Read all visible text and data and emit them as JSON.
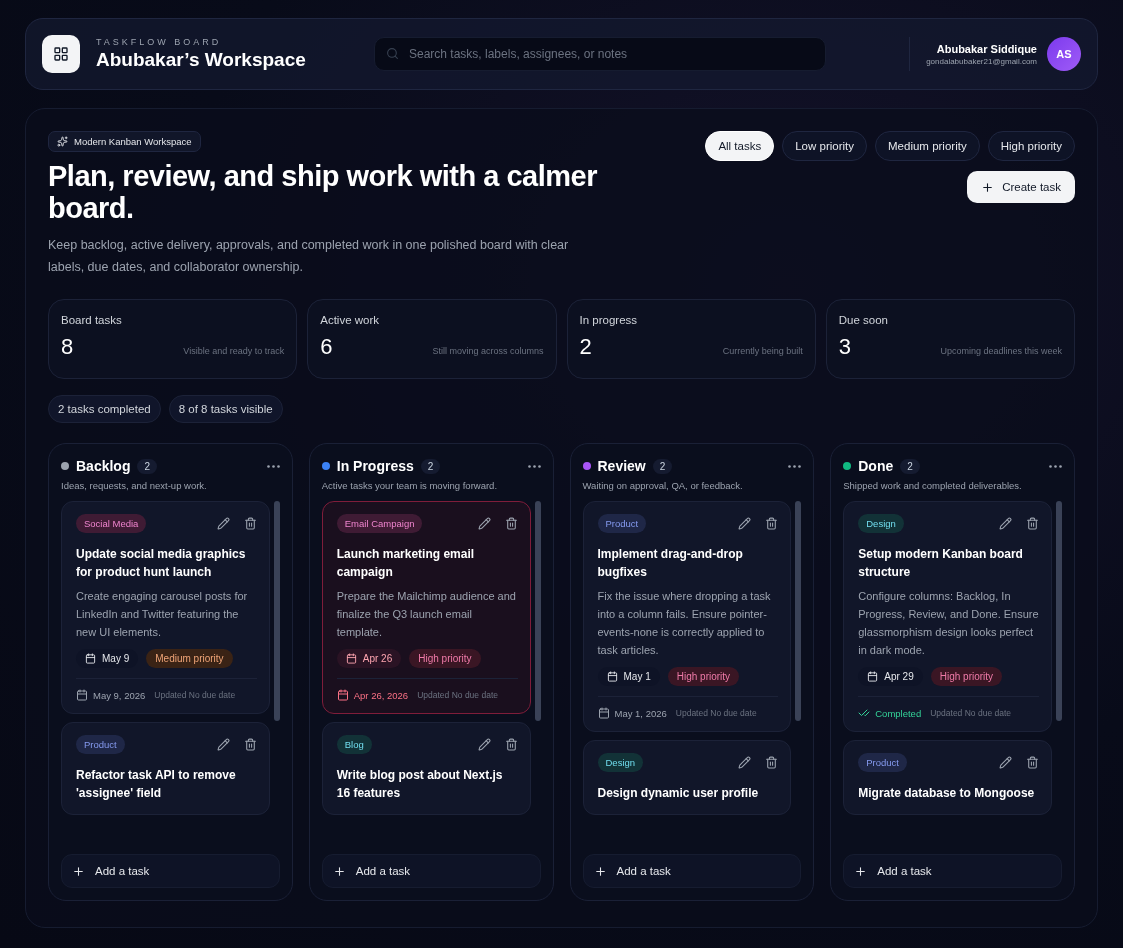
{
  "header": {
    "eyebrow": "TASKFLOW BOARD",
    "title": "Abubakar’s Workspace",
    "search": {
      "placeholder": "Search tasks, labels, assignees, or notes"
    },
    "user": {
      "name": "Abubakar Siddique",
      "email": "gondalabubaker21@gmail.com",
      "initials": "AS"
    }
  },
  "hero": {
    "badge": "Modern Kanban Workspace",
    "title": "Plan, review, and ship work with a calmer board.",
    "description": "Keep backlog, active delivery, approvals, and completed work in one polished board with clear labels, due dates, and collaborator ownership.",
    "filters": [
      {
        "label": "All tasks",
        "selected": true
      },
      {
        "label": "Low priority",
        "selected": false
      },
      {
        "label": "Medium priority",
        "selected": false
      },
      {
        "label": "High priority",
        "selected": false
      }
    ],
    "create_button": "Create task"
  },
  "stats": [
    {
      "label": "Board tasks",
      "value": "8",
      "note": "Visible and ready to track"
    },
    {
      "label": "Active work",
      "value": "6",
      "note": "Still moving across columns"
    },
    {
      "label": "In progress",
      "value": "2",
      "note": "Currently being built"
    },
    {
      "label": "Due soon",
      "value": "3",
      "note": "Upcoming deadlines this week"
    }
  ],
  "summary": [
    "2 tasks completed",
    "8 of 8 tasks visible"
  ],
  "columns": [
    {
      "title": "Backlog",
      "color": "#9ca3af",
      "count": "2",
      "description": "Ideas, requests, and next-up work.",
      "add_label": "Add a task",
      "tasks": [
        {
          "tag": {
            "label": "Social Media",
            "color": "#3f1b34"
          },
          "title": "Update social media graphics for product hunt launch",
          "description": "Create engaging carousel posts for LinkedIn and Twitter featuring the new UI elements.",
          "date_chip": "May 9",
          "priority": {
            "label": "Medium priority",
            "color": "#3a2315"
          },
          "due": "May 9, 2026",
          "updated": "Updated No due date",
          "overdue": false,
          "completed": false
        },
        {
          "tag": {
            "label": "Product",
            "color": "#1f2747"
          },
          "title": "Refactor task API to remove 'assignee' field"
        }
      ]
    },
    {
      "title": "In Progress",
      "color": "#3b82f6",
      "count": "2",
      "description": "Active tasks your team is moving forward.",
      "add_label": "Add a task",
      "tasks": [
        {
          "tag": {
            "label": "Email Campaign",
            "color": "#3f1b34"
          },
          "title": "Launch marketing email campaign",
          "description": "Prepare the Mailchimp audience and finalize the Q3 launch email template.",
          "date_chip": "Apr 26",
          "priority": {
            "label": "High priority",
            "color": "#3a1624"
          },
          "due": "Apr 26, 2026",
          "updated": "Updated No due date",
          "overdue": true,
          "completed": false
        },
        {
          "tag": {
            "label": "Blog",
            "color": "#123237"
          },
          "title": "Write blog post about Next.js 16 features"
        }
      ]
    },
    {
      "title": "Review",
      "color": "#a855f7",
      "count": "2",
      "description": "Waiting on approval, QA, or feedback.",
      "add_label": "Add a task",
      "tasks": [
        {
          "tag": {
            "label": "Product",
            "color": "#1f2747"
          },
          "title": "Implement drag-and-drop bugfixes",
          "description": "Fix the issue where dropping a task into a column fails. Ensure pointer-events-none is correctly applied to task articles.",
          "date_chip": "May 1",
          "priority": {
            "label": "High priority",
            "color": "#3a1624"
          },
          "due": "May 1, 2026",
          "updated": "Updated No due date",
          "overdue": false,
          "completed": false
        },
        {
          "tag": {
            "label": "Design",
            "color": "#123237"
          },
          "title": "Design dynamic user profile"
        }
      ]
    },
    {
      "title": "Done",
      "color": "#10b981",
      "count": "2",
      "description": "Shipped work and completed deliverables.",
      "add_label": "Add a task",
      "tasks": [
        {
          "tag": {
            "label": "Design",
            "color": "#123237"
          },
          "title": "Setup modern Kanban board structure",
          "description": "Configure columns: Backlog, In Progress, Review, and Done. Ensure glassmorphism design looks perfect in dark mode.",
          "date_chip": "Apr 29",
          "priority": {
            "label": "High priority",
            "color": "#3a1624"
          },
          "due": "Completed",
          "updated": "Updated No due date",
          "overdue": false,
          "completed": true
        },
        {
          "tag": {
            "label": "Product",
            "color": "#1f2747"
          },
          "title": "Migrate database to Mongoose"
        }
      ]
    }
  ]
}
